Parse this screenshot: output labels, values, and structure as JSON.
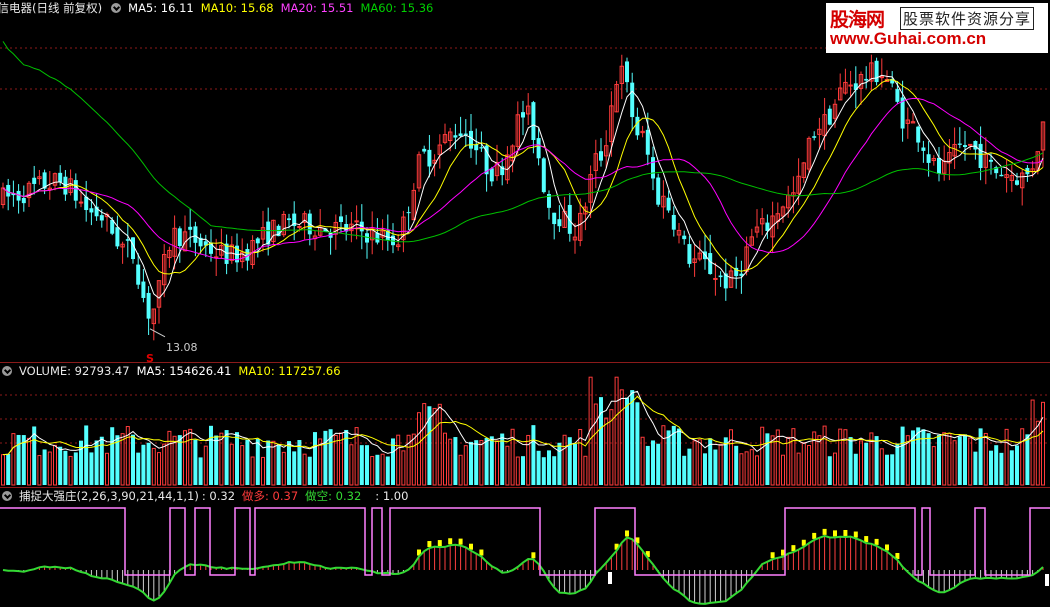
{
  "price_panel": {
    "title": "海信电器(日线 前复权)",
    "ma5": "MA5: 16.11",
    "ma10": "MA10: 15.68",
    "ma20": "MA20: 15.51",
    "ma60": "MA60: 15.36",
    "low_label": "13.08",
    "signal_mark": "S"
  },
  "volume_panel": {
    "volume": "VOLUME: 92793.47",
    "ma5": "MA5: 154626.41",
    "ma10": "MA10: 117257.66"
  },
  "indicator_panel": {
    "name": "捕捉大强庄(2,26,3,90,21,44,1,1)",
    "value": ": 0.32",
    "bull_label": "做多: 0.37",
    "bear_label": "做空: 0.32",
    "extra": ": 1.00"
  },
  "watermark": {
    "brand": "股海网",
    "slogan": "股票软件资源分享",
    "url": "www.Guhai.com.cn"
  },
  "colors": {
    "background": "#000000",
    "candle_up": "#ff3b3b",
    "candle_down": "#54ffff",
    "ma5": "#ffffff",
    "ma10": "#ffff00",
    "ma20": "#ff00ff",
    "ma60": "#00c000",
    "indicator_band": "#ff80ff",
    "indicator_line": "#34d934",
    "indicator_bar": "#ffff00"
  }
}
